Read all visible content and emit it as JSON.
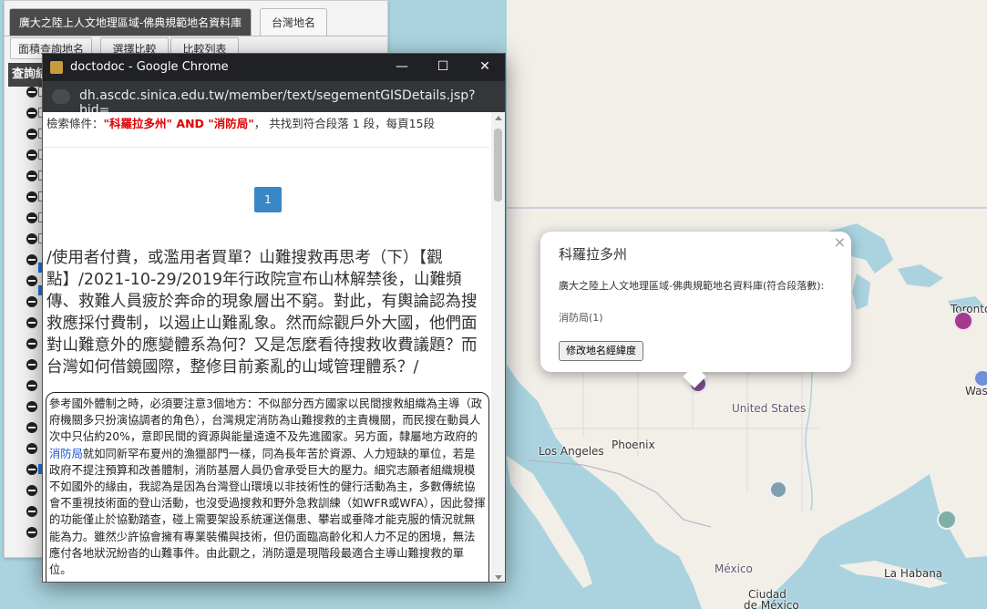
{
  "map": {
    "labels": {
      "united_states": "United States",
      "los_angeles": "Los Angeles",
      "phoenix": "Phoenix",
      "mexico": "México",
      "la_habana": "La Habana",
      "ciudad_de_mexico_1": "Ciudad",
      "ciudad_de_mexico_2": "de México",
      "toronto": "Toronto",
      "washington": "Wash"
    },
    "colors": {
      "water": "#aad3df",
      "land": "#f2efe9",
      "marker_purple": "#7b4a8a",
      "marker_magenta": "#a33a8e",
      "marker_teal": "#7fb0a8",
      "marker_slate": "#7f9fb0",
      "marker_blue": "#6f8fd6"
    }
  },
  "popup": {
    "title": "科羅拉多州",
    "close": "×",
    "body": "廣大之陸上人文地理區域-佛典規範地名資料庫(符合段落數):",
    "count": "消防局(1)",
    "button": "修改地名經緯度"
  },
  "left_panel": {
    "tabs": [
      "廣大之陸上人文地理區域-佛典規範地名資料庫",
      "台灣地名"
    ],
    "subtabs": [
      "面積查詢地名",
      "選擇比較",
      "比較列表"
    ],
    "query_header": "查詢結"
  },
  "chrome": {
    "window_title": "doctodoc - Google Chrome",
    "minimize": "—",
    "maximize": "☐",
    "close": "✕",
    "url": "dh.ascdc.sinica.edu.tw/member/text/segementGISDetails.jsp?bid=...",
    "search": {
      "prefix": "檢索條件：",
      "query": "\"科羅拉多州\" AND \"消防局\"",
      "suffix": "， 共找到符合段落 1 段，每頁15段"
    },
    "page_number": "1",
    "heading": "/使用者付費，或濫用者買單？山難搜救再思考（下）【觀點】/2021-10-29/2019年行政院宣布山林解禁後，山難頻傳、救難人員疲於奔命的現象層出不窮。對此，有輿論認為搜救應採付費制，以遏止山難亂象。然而綜觀戶外大國，他們面對山難意外的應變體系為何？又是怎麼看待搜救收費議題？而台灣如何借鏡國際，整修目前紊亂的山域管理體系？/",
    "paragraph": {
      "before": "參考國外體制之時，必須要注意3個地方：不似部分西方國家以民間搜救組織為主導（政府機關多只扮演協調者的角色），台灣規定消防為山難搜救的主責機關，而民搜在動員人次中只佔約20%，意即民間的資源與能量遠遠不及先進國家。另方面，隸屬地方政府的",
      "highlight": "消防局",
      "after": "就如同新罕布夏州的漁獵部門一樣，同為長年苦於資源、人力短缺的單位，若是政府不提注預算和改善體制，消防基層人員仍會承受巨大的壓力。細究志願者組織規模不如國外的緣由，我認為是因為台灣登山環境以非技術性的健行活動為主，多數傳統協會不重視技術面的登山活動，也沒受過搜救和野外急救訓練（如WFR或WFA），因此發揮的功能僅止於協勤踏查，碰上需要架設系統運送傷患、攀岩或垂降才能克服的情況就無能為力。雖然少許協會擁有專業裝備與技術，但仍面臨高齡化和人力不足的困境，無法應付各地狀況紛沓的山難事件。由此觀之，消防還是現階段最適合主導山難搜救的單位。"
    }
  }
}
